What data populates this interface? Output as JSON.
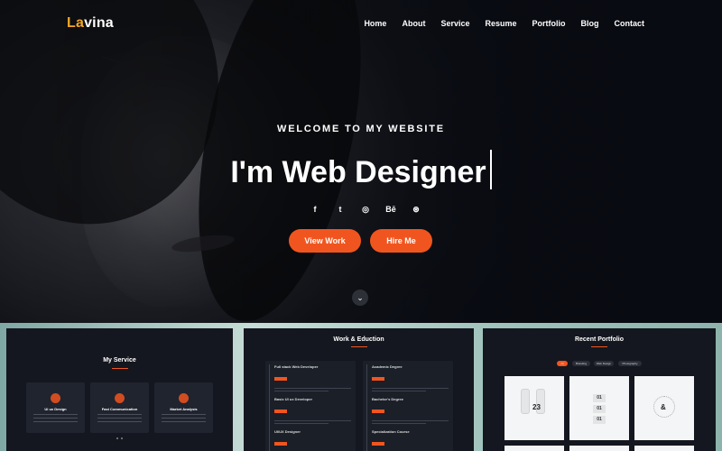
{
  "brand": {
    "logo_accent": "La",
    "logo_rest": "vina"
  },
  "nav": {
    "items": [
      "Home",
      "About",
      "Service",
      "Resume",
      "Portfolio",
      "Blog",
      "Contact"
    ]
  },
  "hero": {
    "eyebrow": "WELCOME TO MY WEBSITE",
    "headline": "I'm Web Designer",
    "socials": [
      {
        "icon": "facebook-icon",
        "glyph": "f"
      },
      {
        "icon": "twitter-icon",
        "glyph": "t"
      },
      {
        "icon": "instagram-icon",
        "glyph": "◎"
      },
      {
        "icon": "behance-icon",
        "glyph": "Bē"
      },
      {
        "icon": "dribbble-icon",
        "glyph": "⊛"
      }
    ],
    "primary_button": "View Work",
    "secondary_button": "Hire Me",
    "scroll_icon": "chevron-down-icon",
    "scroll_glyph": "⌄"
  },
  "previews": {
    "service": {
      "title": "My Service",
      "cards": [
        "Ui ux Design",
        "Fast Communication",
        "Market Analysis"
      ]
    },
    "resume": {
      "title": "Work & Eduction",
      "left": [
        "Full stack Web Developer",
        "Basic UI ux Developer",
        "UI/UX Designer"
      ],
      "right": [
        "Academic Degree",
        "Bachelor's Degree",
        "Specialization Course"
      ]
    },
    "portfolio": {
      "title": "Recent Portfolio",
      "filters": [
        "All",
        "Branding",
        "Web Design",
        "Photography"
      ],
      "thumb_23": "23",
      "thumb_01": "01",
      "thumb_amp": "&"
    }
  },
  "colors": {
    "accent": "#f1551f",
    "logo_accent": "#f5a623",
    "background": "#0c0f17"
  }
}
